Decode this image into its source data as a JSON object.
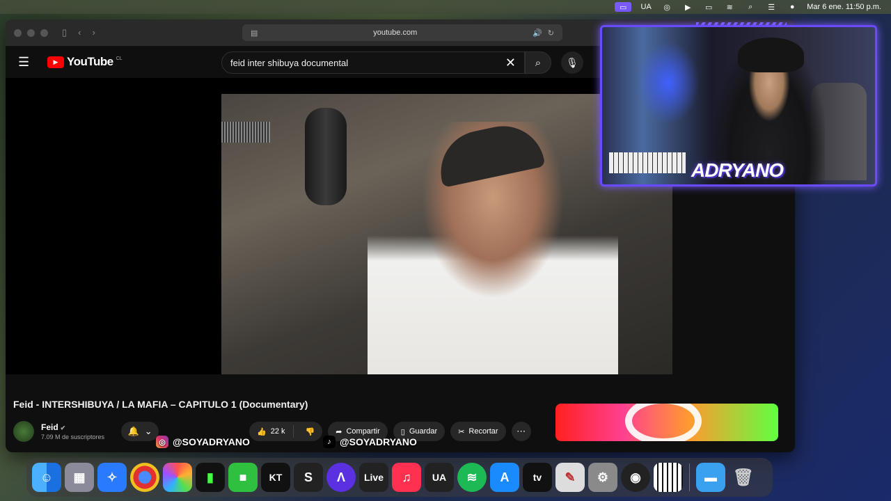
{
  "menubar": {
    "apple": "",
    "items": [
      "UA"
    ],
    "clock": "Mar 6 ene.  11:50 p.m."
  },
  "browser": {
    "url": "youtube.com"
  },
  "youtube": {
    "logo_text": "YouTube",
    "region": "CL",
    "search_query": "feid inter shibuya documental",
    "video_title": "Feid - INTERSHIBUYA / LA MAFIA – CAPITULO 1 (Documentary)",
    "channel_name": "Feid",
    "subscribers": "7.09 M de suscriptores",
    "likes": "22 k",
    "share_label": "Compartir",
    "save_label": "Guardar",
    "clip_label": "Recortar"
  },
  "overlay": {
    "instagram": "@SOYADRYANO",
    "tiktok": "@SOYADRYANO",
    "streamer_name": "ADRYANO"
  },
  "dock": {
    "items": [
      "Finder",
      "Launchpad",
      "Safari",
      "Chrome",
      "Photos",
      "Stats",
      "FaceTime",
      "KT",
      "S",
      "Aura",
      "Live",
      "Music",
      "UA",
      "Spotify",
      "App Store",
      "tv",
      "Notes",
      "Settings",
      "OBS",
      "Piano",
      "Folder",
      "Trash"
    ],
    "live_label": "Live",
    "ua_label": "UA",
    "tv_label": "tv",
    "kt_label": "KT"
  }
}
